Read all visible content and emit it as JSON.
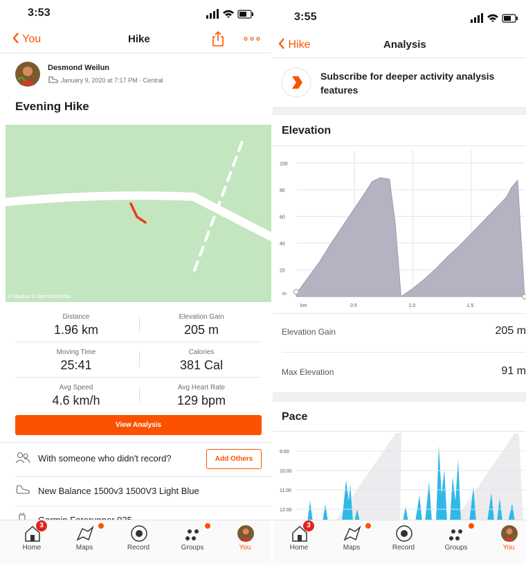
{
  "left": {
    "status_time": "3:53",
    "nav": {
      "back_label": "You",
      "title": "Hike"
    },
    "athlete": {
      "name": "Desmond Weilun",
      "date": "January 9, 2020 at 7:17 PM · Central"
    },
    "activity_title": "Evening Hike",
    "map_attribution": "© Mapbox © OpenStreetMap",
    "stats": [
      {
        "label": "Distance",
        "value": "1.96 km"
      },
      {
        "label": "Elevation Gain",
        "value": "205 m"
      },
      {
        "label": "Moving Time",
        "value": "25:41"
      },
      {
        "label": "Calories",
        "value": "381 Cal"
      },
      {
        "label": "Avg Speed",
        "value": "4.6 km/h"
      },
      {
        "label": "Avg Heart Rate",
        "value": "129 bpm"
      }
    ],
    "view_analysis_label": "View Analysis",
    "others_text": "With someone who didn't record?",
    "add_others_label": "Add Others",
    "shoe_text": "New Balance 1500v3 1500V3 Light Blue",
    "device_text": "Garmin Forerunner 935"
  },
  "right": {
    "status_time": "3:55",
    "nav": {
      "back_label": "Hike",
      "title": "Analysis"
    },
    "subscribe_text": "Subscribe for deeper activity analysis features",
    "elevation_title": "Elevation",
    "elevation_gain_label": "Elevation Gain",
    "elevation_gain_value": "205 m",
    "max_elevation_label": "Max Elevation",
    "max_elevation_value": "91 m",
    "pace_title": "Pace"
  },
  "tabs": [
    {
      "label": "Home",
      "icon": "home-icon",
      "badge": "3"
    },
    {
      "label": "Maps",
      "icon": "maps-icon"
    },
    {
      "label": "Record",
      "icon": "record-icon"
    },
    {
      "label": "Groups",
      "icon": "groups-icon"
    },
    {
      "label": "You",
      "icon": "avatar"
    }
  ],
  "colors": {
    "accent": "#fc5200",
    "map_green": "#c3e6c0",
    "elevation_fill": "#b3b3c2",
    "pace_fill": "#2fb9e8",
    "badge_red": "#e1241d"
  },
  "chart_data": [
    {
      "type": "area",
      "title": "Elevation",
      "x_unit": "km",
      "y_unit": "m",
      "xticks": [
        "0.5",
        "1.0",
        "1.5"
      ],
      "yticks": [
        "20",
        "40",
        "60",
        "80",
        "100"
      ],
      "xlim": [
        0,
        1.96
      ],
      "ylim": [
        0,
        110
      ],
      "x": [
        0,
        0.1,
        0.2,
        0.3,
        0.4,
        0.5,
        0.6,
        0.65,
        0.72,
        0.8,
        0.85,
        0.9,
        1.0,
        1.1,
        1.2,
        1.3,
        1.4,
        1.5,
        1.6,
        1.7,
        1.8,
        1.85,
        1.9,
        1.96
      ],
      "y": [
        2,
        14,
        26,
        40,
        53,
        66,
        79,
        86,
        89,
        88,
        55,
        0,
        6,
        13,
        21,
        30,
        38,
        47,
        56,
        65,
        74,
        82,
        87,
        0
      ]
    },
    {
      "type": "area",
      "title": "Pace",
      "yticks": [
        "9:00",
        "10:00",
        "11:00",
        "12:00"
      ]
    }
  ]
}
